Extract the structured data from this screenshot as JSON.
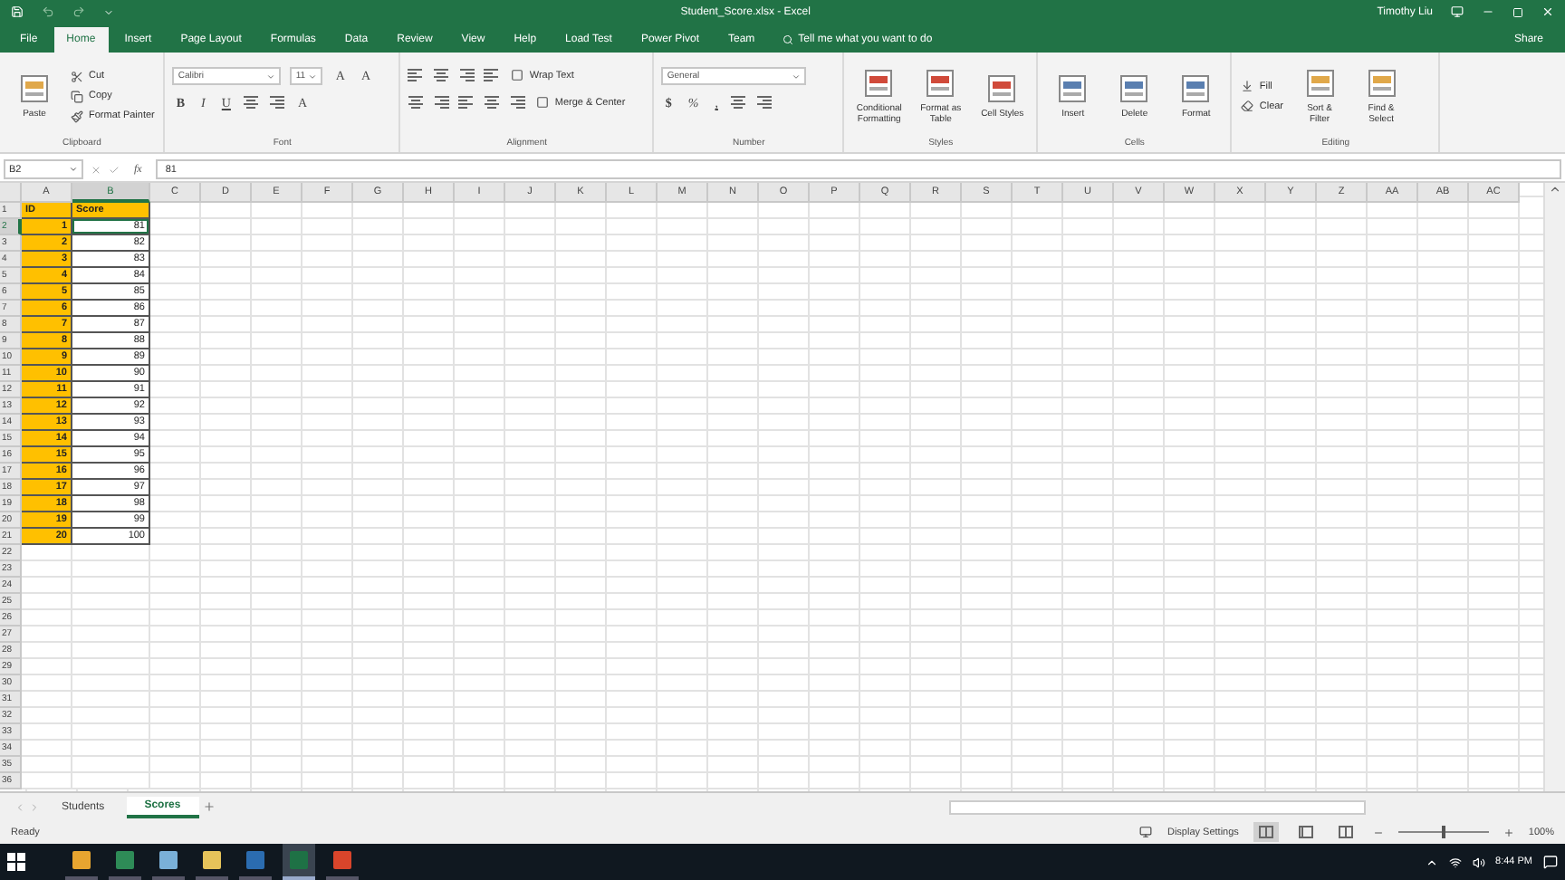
{
  "title_bar": {
    "title": "Student_Score.xlsx - Excel",
    "user": "Timothy Liu"
  },
  "ribbon_tabs": [
    {
      "label": "File",
      "selected": false
    },
    {
      "label": "Home",
      "selected": true
    },
    {
      "label": "Insert",
      "selected": false
    },
    {
      "label": "Page Layout",
      "selected": false
    },
    {
      "label": "Formulas",
      "selected": false
    },
    {
      "label": "Data",
      "selected": false
    },
    {
      "label": "Review",
      "selected": false
    },
    {
      "label": "View",
      "selected": false
    },
    {
      "label": "Help",
      "selected": false
    },
    {
      "label": "Load Test",
      "selected": false
    },
    {
      "label": "Power Pivot",
      "selected": false
    },
    {
      "label": "Team",
      "selected": false
    }
  ],
  "tell_me": {
    "placeholder": "Tell me what you want to do"
  },
  "share": "Share",
  "ribbon_groups": [
    {
      "name": "Clipboard",
      "kind": "columns",
      "columns": [
        [
          {
            "kind": "big",
            "label": "Paste"
          }
        ],
        [
          {
            "kind": "small",
            "label": "Cut"
          },
          {
            "kind": "small",
            "label": "Copy"
          },
          {
            "kind": "small",
            "label": "Format Painter"
          }
        ]
      ]
    },
    {
      "name": "Font",
      "kind": "rows",
      "columns": [
        [
          {
            "kind": "combo",
            "label": "Calibri"
          },
          {
            "kind": "combo",
            "label": "11"
          },
          {
            "kind": "glyph",
            "label": "A"
          },
          {
            "kind": "glyph",
            "label": "A"
          }
        ],
        [
          {
            "kind": "glyph",
            "label": "B"
          },
          {
            "kind": "glyph",
            "label": "I"
          },
          {
            "kind": "glyph",
            "label": "U"
          },
          {
            "kind": "icon"
          },
          {
            "kind": "icon"
          },
          {
            "kind": "glyph",
            "label": "A"
          }
        ]
      ]
    },
    {
      "name": "Alignment",
      "kind": "rows",
      "columns": [
        [
          {
            "kind": "icon"
          },
          {
            "kind": "icon"
          },
          {
            "kind": "icon"
          },
          {
            "kind": "icon"
          },
          {
            "kind": "small",
            "label": "Wrap Text"
          }
        ],
        [
          {
            "kind": "icon"
          },
          {
            "kind": "icon"
          },
          {
            "kind": "icon"
          },
          {
            "kind": "icon"
          },
          {
            "kind": "icon"
          },
          {
            "kind": "small",
            "label": "Merge & Center"
          }
        ]
      ]
    },
    {
      "name": "Number",
      "kind": "rows",
      "columns": [
        [
          {
            "kind": "combo",
            "label": "General"
          }
        ],
        [
          {
            "kind": "glyph",
            "label": "$"
          },
          {
            "kind": "glyph",
            "label": "%"
          },
          {
            "kind": "glyph",
            "label": ","
          },
          {
            "kind": "icon"
          },
          {
            "kind": "icon"
          }
        ]
      ]
    },
    {
      "name": "Styles",
      "kind": "columns",
      "columns": [
        [
          {
            "kind": "big",
            "label": "Conditional Formatting"
          }
        ],
        [
          {
            "kind": "big",
            "label": "Format as Table"
          }
        ],
        [
          {
            "kind": "big",
            "label": "Cell Styles"
          }
        ]
      ]
    },
    {
      "name": "Cells",
      "kind": "columns",
      "columns": [
        [
          {
            "kind": "big",
            "label": "Insert"
          }
        ],
        [
          {
            "kind": "big",
            "label": "Delete"
          }
        ],
        [
          {
            "kind": "big",
            "label": "Format"
          }
        ]
      ]
    },
    {
      "name": "Editing",
      "kind": "columns",
      "columns": [
        [
          {
            "kind": "small",
            "label": "Fill"
          },
          {
            "kind": "small",
            "label": "Clear"
          }
        ],
        [
          {
            "kind": "big",
            "label": "Sort & Filter"
          }
        ],
        [
          {
            "kind": "big",
            "label": "Find & Select"
          }
        ]
      ]
    }
  ],
  "formula_bar": {
    "name_box": "B2",
    "function_label": "fx",
    "value": "81"
  },
  "sheet": {
    "columns": [
      {
        "label": "A",
        "selected": false
      },
      {
        "label": "B",
        "selected": true
      },
      {
        "label": "C",
        "selected": false
      },
      {
        "label": "D",
        "selected": false
      },
      {
        "label": "E",
        "selected": false
      },
      {
        "label": "F",
        "selected": false
      },
      {
        "label": "G",
        "selected": false
      },
      {
        "label": "H",
        "selected": false
      },
      {
        "label": "I",
        "selected": false
      },
      {
        "label": "J",
        "selected": false
      },
      {
        "label": "K",
        "selected": false
      },
      {
        "label": "L",
        "selected": false
      },
      {
        "label": "M",
        "selected": false
      },
      {
        "label": "N",
        "selected": false
      },
      {
        "label": "O",
        "selected": false
      },
      {
        "label": "P",
        "selected": false
      },
      {
        "label": "Q",
        "selected": false
      },
      {
        "label": "R",
        "selected": false
      },
      {
        "label": "S",
        "selected": false
      },
      {
        "label": "T",
        "selected": false
      },
      {
        "label": "U",
        "selected": false
      },
      {
        "label": "V",
        "selected": false
      },
      {
        "label": "W",
        "selected": false
      },
      {
        "label": "X",
        "selected": false
      },
      {
        "label": "Y",
        "selected": false
      },
      {
        "label": "Z",
        "selected": false
      },
      {
        "label": "AA",
        "selected": false
      },
      {
        "label": "AB",
        "selected": false
      },
      {
        "label": "AC",
        "selected": false
      }
    ],
    "rows": [
      {
        "label": "1",
        "selected": false,
        "cells": [
          {
            "text": "ID",
            "selected": false
          },
          {
            "text": "Score",
            "selected": false
          }
        ]
      },
      {
        "label": "2",
        "selected": true,
        "cells": [
          {
            "text": "1",
            "selected": false
          },
          {
            "text": "81",
            "selected": true
          }
        ]
      },
      {
        "label": "3",
        "selected": false,
        "cells": [
          {
            "text": "2",
            "selected": false
          },
          {
            "text": "82",
            "selected": false
          }
        ]
      },
      {
        "label": "4",
        "selected": false,
        "cells": [
          {
            "text": "3",
            "selected": false
          },
          {
            "text": "83",
            "selected": false
          }
        ]
      },
      {
        "label": "5",
        "selected": false,
        "cells": [
          {
            "text": "4",
            "selected": false
          },
          {
            "text": "84",
            "selected": false
          }
        ]
      },
      {
        "label": "6",
        "selected": false,
        "cells": [
          {
            "text": "5",
            "selected": false
          },
          {
            "text": "85",
            "selected": false
          }
        ]
      },
      {
        "label": "7",
        "selected": false,
        "cells": [
          {
            "text": "6",
            "selected": false
          },
          {
            "text": "86",
            "selected": false
          }
        ]
      },
      {
        "label": "8",
        "selected": false,
        "cells": [
          {
            "text": "7",
            "selected": false
          },
          {
            "text": "87",
            "selected": false
          }
        ]
      },
      {
        "label": "9",
        "selected": false,
        "cells": [
          {
            "text": "8",
            "selected": false
          },
          {
            "text": "88",
            "selected": false
          }
        ]
      },
      {
        "label": "10",
        "selected": false,
        "cells": [
          {
            "text": "9",
            "selected": false
          },
          {
            "text": "89",
            "selected": false
          }
        ]
      },
      {
        "label": "11",
        "selected": false,
        "cells": [
          {
            "text": "10",
            "selected": false
          },
          {
            "text": "90",
            "selected": false
          }
        ]
      },
      {
        "label": "12",
        "selected": false,
        "cells": [
          {
            "text": "11",
            "selected": false
          },
          {
            "text": "91",
            "selected": false
          }
        ]
      },
      {
        "label": "13",
        "selected": false,
        "cells": [
          {
            "text": "12",
            "selected": false
          },
          {
            "text": "92",
            "selected": false
          }
        ]
      },
      {
        "label": "14",
        "selected": false,
        "cells": [
          {
            "text": "13",
            "selected": false
          },
          {
            "text": "93",
            "selected": false
          }
        ]
      },
      {
        "label": "15",
        "selected": false,
        "cells": [
          {
            "text": "14",
            "selected": false
          },
          {
            "text": "94",
            "selected": false
          }
        ]
      },
      {
        "label": "16",
        "selected": false,
        "cells": [
          {
            "text": "15",
            "selected": false
          },
          {
            "text": "95",
            "selected": false
          }
        ]
      },
      {
        "label": "17",
        "selected": false,
        "cells": [
          {
            "text": "16",
            "selected": false
          },
          {
            "text": "96",
            "selected": false
          }
        ]
      },
      {
        "label": "18",
        "selected": false,
        "cells": [
          {
            "text": "17",
            "selected": false
          },
          {
            "text": "97",
            "selected": false
          }
        ]
      },
      {
        "label": "19",
        "selected": false,
        "cells": [
          {
            "text": "18",
            "selected": false
          },
          {
            "text": "98",
            "selected": false
          }
        ]
      },
      {
        "label": "20",
        "selected": false,
        "cells": [
          {
            "text": "19",
            "selected": false
          },
          {
            "text": "99",
            "selected": false
          }
        ]
      },
      {
        "label": "21",
        "selected": false,
        "cells": [
          {
            "text": "20",
            "selected": false
          },
          {
            "text": "100",
            "selected": false
          }
        ]
      },
      {
        "label": "22",
        "selected": false,
        "cells": []
      },
      {
        "label": "23",
        "selected": false,
        "cells": []
      },
      {
        "label": "24",
        "selected": false,
        "cells": []
      },
      {
        "label": "25",
        "selected": false,
        "cells": []
      },
      {
        "label": "26",
        "selected": false,
        "cells": []
      },
      {
        "label": "27",
        "selected": false,
        "cells": []
      },
      {
        "label": "28",
        "selected": false,
        "cells": []
      },
      {
        "label": "29",
        "selected": false,
        "cells": []
      },
      {
        "label": "30",
        "selected": false,
        "cells": []
      },
      {
        "label": "31",
        "selected": false,
        "cells": []
      },
      {
        "label": "32",
        "selected": false,
        "cells": []
      },
      {
        "label": "33",
        "selected": false,
        "cells": []
      },
      {
        "label": "34",
        "selected": false,
        "cells": []
      },
      {
        "label": "35",
        "selected": false,
        "cells": []
      },
      {
        "label": "36",
        "selected": false,
        "cells": []
      }
    ]
  },
  "sheet_tabs": [
    {
      "label": "Students",
      "selected": false
    },
    {
      "label": "Scores",
      "selected": true
    }
  ],
  "status_bar": {
    "status": "Ready",
    "display_settings": "Display Settings",
    "views": [
      {
        "selected": true
      },
      {
        "selected": false
      },
      {
        "selected": false
      }
    ],
    "zoom": {
      "level": 0.5
    },
    "zoom_label": "100%"
  },
  "taskbar": {
    "apps": [
      {
        "color": "#e8a530",
        "selected": false
      },
      {
        "color": "#2e8b57",
        "selected": false
      },
      {
        "color": "#7ab0d8",
        "selected": false
      },
      {
        "color": "#e6c35a",
        "selected": false
      },
      {
        "color": "#2b6cb0",
        "selected": false
      },
      {
        "color": "#1e7145",
        "selected": true
      },
      {
        "color": "#d9452b",
        "selected": false
      }
    ],
    "time": "8:44 PM"
  }
}
